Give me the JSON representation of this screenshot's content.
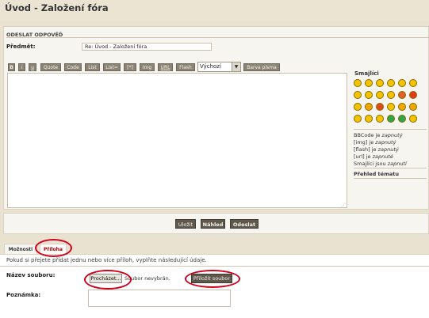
{
  "page": {
    "title": "Úvod - Založení fóra"
  },
  "post_form": {
    "heading": "ODESLAT ODPOVĚĎ",
    "subject_label": "Předmět:",
    "subject_value": "Re: Úvod - Založení fóra"
  },
  "toolbar": {
    "buttons": [
      "B",
      "i",
      "u",
      "Quote",
      "Code",
      "List",
      "List=",
      "[*]",
      "Img",
      "URL",
      "Flash"
    ],
    "font_select_value": "Výchozí",
    "font_color_label": "Barva písma"
  },
  "sidebar": {
    "smilies_title": "Smajlíci",
    "bbcode_status": "BBCode je",
    "bbcode_state": "zapnutý",
    "img_status": "[img] je",
    "img_state": "zapnutý",
    "flash_status": "[flash] je",
    "flash_state": "zapnutý",
    "url_status": "[url] je",
    "url_state": "zapnuté",
    "smilies_status": "Smajlíci jsou",
    "smilies_state": "zapnutí",
    "topic_review": "Přehled tématu"
  },
  "submit": {
    "save_label": "Uložit",
    "preview_label": "Náhled",
    "submit_label": "Odeslat"
  },
  "tabs": {
    "options_label": "Možnosti",
    "attachment_label": "Příloha"
  },
  "attachment": {
    "info_text": "Pokud si přejete přidat jednu nebo více příloh, vyplňte následující údaje.",
    "filename_label": "Název souboru:",
    "browse_label": "Procházet...",
    "no_file_text": "Soubor nevybrán.",
    "add_file_label": "Přiložit soubor",
    "comment_label": "Poznámka:"
  },
  "colors": {
    "highlight_ring": "#d0021b",
    "button_dark": "#5e584d",
    "toolbar_button": "#8b8476",
    "smiley_yellow": "#f5c400"
  },
  "icons": {
    "smilies": [
      "smile",
      "grin",
      "wink",
      "biggrin",
      "surprised",
      "confused",
      "cool",
      "razz",
      "rolleyes",
      "neutral",
      "redface",
      "evil",
      "sad",
      "mad",
      "twisted",
      "lol",
      "exclaim",
      "question",
      "idea",
      "arrow",
      "eek",
      "alien",
      "green",
      "cry"
    ]
  }
}
